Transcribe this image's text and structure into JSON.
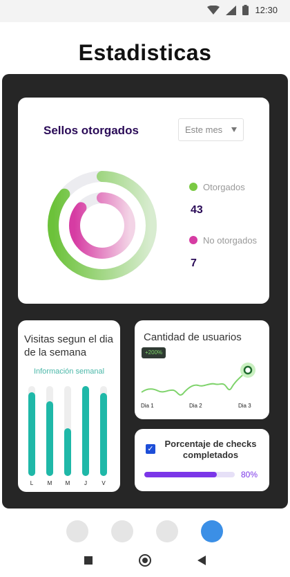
{
  "status_bar": {
    "time": "12:30",
    "icons": [
      "wifi-icon",
      "signal-icon",
      "battery-icon"
    ]
  },
  "page": {
    "title": "Estadisticas"
  },
  "sellos": {
    "title": "Sellos otorgados",
    "period": "Este mes",
    "legend": [
      {
        "label": "Otorgados",
        "value": "43",
        "color": "#7ac943"
      },
      {
        "label": "No otorgados",
        "value": "7",
        "color": "#d63ca3"
      }
    ],
    "outer_ring_percent": 86,
    "inner_ring_percent": 86
  },
  "visitas": {
    "title": "Visitas segun el dia de la semana",
    "subtitle": "Información semanal",
    "bar_color": "#1fb8a8",
    "days": [
      {
        "label": "L",
        "value": 0.93
      },
      {
        "label": "M",
        "value": 0.83
      },
      {
        "label": "M",
        "value": 0.53
      },
      {
        "label": "J",
        "value": 1.0
      },
      {
        "label": "V",
        "value": 0.92
      }
    ]
  },
  "usuarios": {
    "title": "Cantidad de usuarios",
    "badge": "+200%",
    "line_color": "#7ed36b",
    "x_labels": [
      "Dia 1",
      "Dia 2",
      "Dia 3"
    ]
  },
  "checks": {
    "title": "Porcentaje de checks completados",
    "checked": true,
    "percent": 80,
    "percent_label": "80%",
    "color": "#7b36e8"
  },
  "pager": {
    "count": 4,
    "active_index": 3,
    "active_color": "#3b8fe6"
  }
}
